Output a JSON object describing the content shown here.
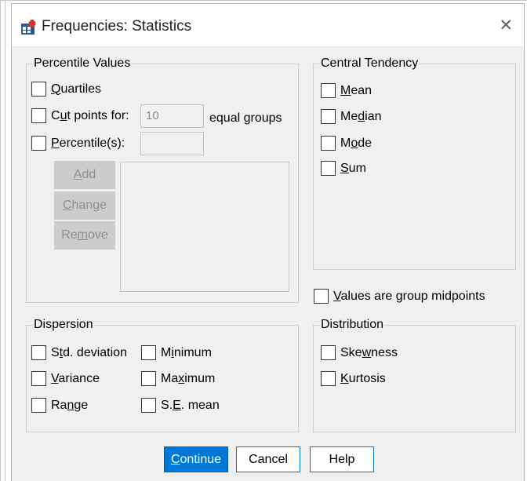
{
  "dialog": {
    "title": "Frequencies: Statistics",
    "close_glyph": "✕"
  },
  "percentile_values": {
    "title": "Percentile Values",
    "quartiles": {
      "pre": "",
      "key": "Q",
      "post": "uartiles",
      "checked": false
    },
    "cut_points": {
      "pre": "C",
      "key": "u",
      "post": "t points for:",
      "checked": false
    },
    "cut_points_value": "10",
    "equal_groups_label": "equal groups",
    "percentiles": {
      "pre": "",
      "key": "P",
      "post": "ercentile(s):",
      "checked": false
    },
    "percentile_value": "",
    "add_button": {
      "pre": "",
      "key": "A",
      "post": "dd"
    },
    "change_button": {
      "pre": "",
      "key": "C",
      "post": "hange"
    },
    "remove_button": {
      "pre": "Re",
      "key": "m",
      "post": "ove"
    },
    "list_items": []
  },
  "central_tendency": {
    "title": "Central Tendency",
    "mean": {
      "pre": "",
      "key": "M",
      "post": "ean",
      "checked": false
    },
    "median": {
      "pre": "Me",
      "key": "d",
      "post": "ian",
      "checked": false
    },
    "mode": {
      "pre": "M",
      "key": "o",
      "post": "de",
      "checked": false
    },
    "sum": {
      "pre": "",
      "key": "S",
      "post": "um",
      "checked": false
    }
  },
  "group_midpoints": {
    "pre": "",
    "key": "V",
    "post": "alues are group midpoints",
    "checked": false
  },
  "dispersion": {
    "title": "Dispersion",
    "std_deviation": {
      "pre": "S",
      "key": "t",
      "post": "d. deviation",
      "checked": false
    },
    "variance": {
      "pre": "",
      "key": "V",
      "post": "ariance",
      "checked": false
    },
    "range": {
      "pre": "Ra",
      "key": "n",
      "post": "ge",
      "checked": false
    },
    "minimum": {
      "pre": "M",
      "key": "i",
      "post": "nimum",
      "checked": false
    },
    "maximum": {
      "pre": "Ma",
      "key": "x",
      "post": "imum",
      "checked": false
    },
    "se_mean": {
      "pre": "S.",
      "key": "E",
      "post": ". mean",
      "checked": false
    }
  },
  "distribution": {
    "title": "Distribution",
    "skewness": {
      "pre": "Ske",
      "key": "w",
      "post": "ness",
      "checked": false
    },
    "kurtosis": {
      "pre": "",
      "key": "K",
      "post": "urtosis",
      "checked": false
    }
  },
  "buttons": {
    "continue": {
      "pre": "",
      "key": "C",
      "post": "ontinue"
    },
    "cancel": {
      "pre": "",
      "key": "",
      "post": "Cancel"
    },
    "help": {
      "pre": "",
      "key": "",
      "post": "Help"
    }
  },
  "colors": {
    "dialog_bg": "#f0f0f0",
    "titlebar_bg": "#ffffff",
    "accent": "#0078d7",
    "disabled_button": "#cccccc",
    "disabled_text": "#8f8f8f"
  },
  "icons": {
    "app": "spss-app-icon",
    "close": "close-icon"
  }
}
